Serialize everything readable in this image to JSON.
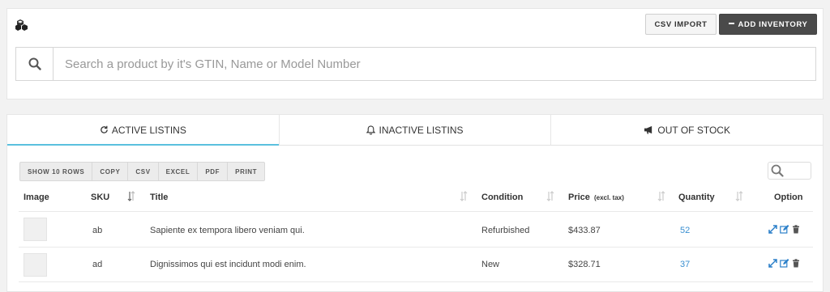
{
  "header": {
    "logo_icon": "stack-boxes-icon",
    "csv_import_label": "CSV IMPORT",
    "add_inventory_label": "ADD INVENTORY"
  },
  "search": {
    "placeholder": "Search a product by it's GTIN, Name or Model Number",
    "value": ""
  },
  "tabs": [
    {
      "label": "ACTIVE LISTINS",
      "icon": "refresh-icon",
      "active": true
    },
    {
      "label": "INACTIVE LISTINS",
      "icon": "bell-icon",
      "active": false
    },
    {
      "label": "OUT OF STOCK",
      "icon": "megaphone-icon",
      "active": false
    }
  ],
  "table_tools": [
    "SHOW 10 ROWS",
    "COPY",
    "CSV",
    "EXCEL",
    "PDF",
    "PRINT"
  ],
  "table": {
    "columns": [
      "Image",
      "SKU",
      "Title",
      "Condition",
      "Price",
      "(excl. tax)",
      "Quantity",
      "Option"
    ],
    "rows": [
      {
        "sku": "ab",
        "title": "Sapiente ex tempora libero veniam qui.",
        "condition": "Refurbished",
        "price": "$433.87",
        "quantity": "52"
      },
      {
        "sku": "ad",
        "title": "Dignissimos qui est incidunt modi enim.",
        "condition": "New",
        "price": "$328.71",
        "quantity": "37"
      }
    ]
  },
  "colors": {
    "accent": "#5bc0de",
    "link": "#3a8fd1",
    "primary_button": "#4a4a4a"
  }
}
